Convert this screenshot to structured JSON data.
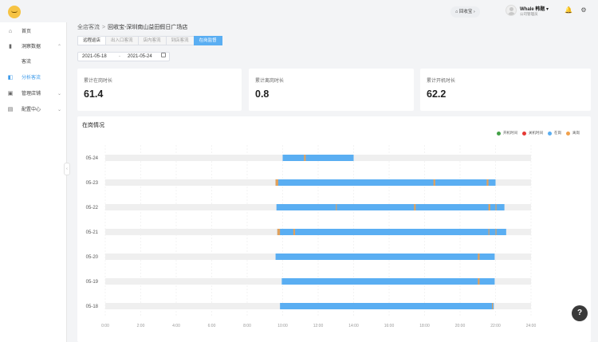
{
  "header": {
    "store_switch_label": "回收宝",
    "store_switch_chevron": "›",
    "user_name": "Whale 韩题",
    "user_role": "公司管理员",
    "icons": [
      "bell-icon",
      "settings-icon"
    ]
  },
  "sidebar": {
    "items": [
      {
        "label": "首页",
        "icon": "home-icon",
        "glyph": "⌂",
        "chevron": ""
      },
      {
        "label": "洞察数据",
        "icon": "bar-chart-icon",
        "glyph": "▮",
        "chevron": "⌃"
      },
      {
        "label": "客流",
        "icon": "",
        "glyph": "",
        "chevron": ""
      },
      {
        "label": "分析客流",
        "icon": "analysis-icon",
        "glyph": "◧",
        "chevron": ""
      },
      {
        "label": "管理店铺",
        "icon": "store-icon",
        "glyph": "▣",
        "chevron": "⌄"
      },
      {
        "label": "配置中心",
        "icon": "config-icon",
        "glyph": "▤",
        "chevron": "⌄"
      }
    ],
    "active_index": 3,
    "collapse_glyph": "‹"
  },
  "breadcrumb": {
    "root": "全店客流",
    "separator": ">",
    "current": "回收宝-深圳南山益田假日广场店"
  },
  "tabs": [
    "远程巡店",
    "出入口客流",
    "店内客流",
    "到店客流",
    "在岗监督"
  ],
  "active_tab": 4,
  "date_range": {
    "start": "2021-05-18",
    "separator": "-",
    "end": "2021-05-24"
  },
  "cards": [
    {
      "label": "累计在岗时长",
      "value": "61.4"
    },
    {
      "label": "累计离岗时长",
      "value": "0.8"
    },
    {
      "label": "累计开机时长",
      "value": "62.2"
    }
  ],
  "colors": {
    "power_on": "#43a047",
    "power_off": "#e53935",
    "on_duty": "#5aaef2",
    "off_duty": "#f0a04b",
    "track": "#efefef",
    "accent": "#3d9bea"
  },
  "chart_data": {
    "type": "timeline",
    "title": "在岗情况",
    "legend": [
      {
        "name": "开机时间",
        "color": "#43a047"
      },
      {
        "name": "关机时间",
        "color": "#e53935"
      },
      {
        "name": "在岗",
        "color": "#5aaef2"
      },
      {
        "name": "离岗",
        "color": "#f0a04b"
      }
    ],
    "x_ticks": [
      "0:00",
      "2:00",
      "4:00",
      "6:00",
      "8:00",
      "10:00",
      "12:00",
      "14:00",
      "16:00",
      "18:00",
      "20:00",
      "22:00",
      "24:00"
    ],
    "xlim": [
      0,
      24
    ],
    "x_unit": "hour",
    "grid": true,
    "legend_position": "top-right",
    "categories": [
      "05-24",
      "05-23",
      "05-22",
      "05-21",
      "05-20",
      "05-19",
      "05-18"
    ],
    "rows": [
      {
        "date": "05-24",
        "on_duty": [
          [
            10.0,
            14.0
          ]
        ],
        "off_duty": [
          [
            11.2,
            11.3
          ]
        ]
      },
      {
        "date": "05-23",
        "on_duty": [
          [
            9.6,
            22.0
          ]
        ],
        "off_duty": [
          [
            9.6,
            9.75
          ],
          [
            18.5,
            18.6
          ],
          [
            21.5,
            21.6
          ]
        ]
      },
      {
        "date": "05-22",
        "on_duty": [
          [
            9.65,
            22.5
          ]
        ],
        "off_duty": [
          [
            13.0,
            13.05
          ],
          [
            17.4,
            17.5
          ],
          [
            21.6,
            21.7
          ],
          [
            22.0,
            22.05
          ]
        ]
      },
      {
        "date": "05-21",
        "on_duty": [
          [
            9.7,
            22.6
          ]
        ],
        "off_duty": [
          [
            9.7,
            9.85
          ],
          [
            10.6,
            10.7
          ],
          [
            21.6,
            21.65
          ],
          [
            22.0,
            22.05
          ]
        ]
      },
      {
        "date": "05-20",
        "on_duty": [
          [
            9.6,
            21.95
          ]
        ],
        "off_duty": [
          [
            21.0,
            21.1
          ]
        ]
      },
      {
        "date": "05-19",
        "on_duty": [
          [
            9.95,
            21.95
          ]
        ],
        "off_duty": [
          [
            21.0,
            21.1
          ]
        ]
      },
      {
        "date": "05-18",
        "on_duty": [
          [
            9.85,
            21.9
          ]
        ],
        "off_duty": [
          [
            21.8,
            21.85
          ]
        ]
      }
    ]
  },
  "help_label": "?"
}
